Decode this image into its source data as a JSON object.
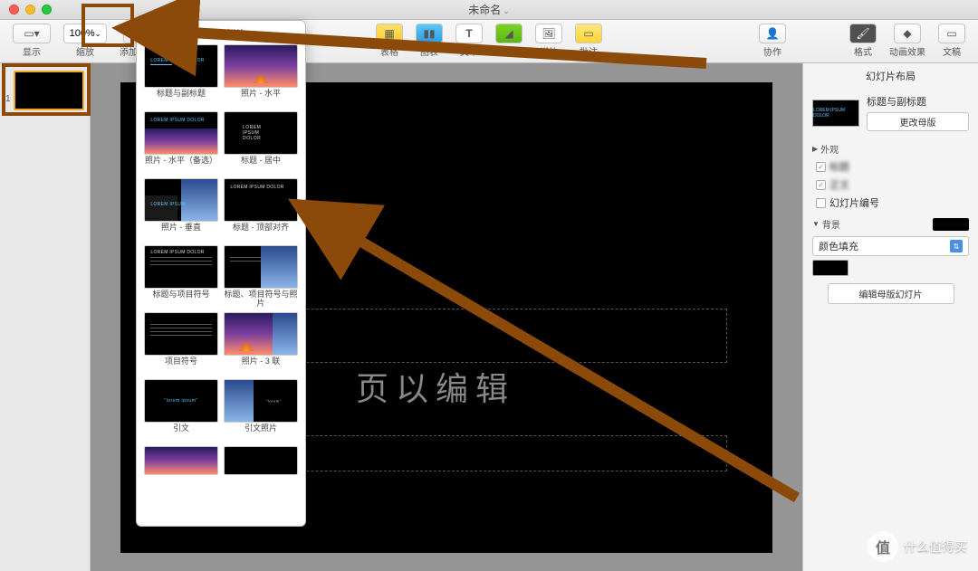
{
  "window": {
    "title": "未命名"
  },
  "toolbar": {
    "view": "显示",
    "zoom_value": "100%",
    "zoom_label": "缩放",
    "add_slide": "添加幻灯片",
    "table": "表格",
    "chart": "图表",
    "text": "文本",
    "shape": "形状",
    "media": "媒体",
    "comment": "批注",
    "collab": "协作",
    "format": "格式",
    "animate": "动画效果",
    "document": "文稿"
  },
  "slide_nav": {
    "slide1_num": "1"
  },
  "canvas": {
    "edit_hint": "页以编辑"
  },
  "popover": {
    "title": "添加幻灯片",
    "layouts": [
      {
        "label": "标题与副标题",
        "sample": "LOREM IPSUM DOLOR"
      },
      {
        "label": "照片 - 水平",
        "sample": ""
      },
      {
        "label": "照片 - 水平（备选）",
        "sample": "LOREM IPSUM DOLOR"
      },
      {
        "label": "标题 - 居中",
        "sample": "LOREM IPSUM DOLOR"
      },
      {
        "label": "照片 - 垂直",
        "sample": "LOREM IPSUM"
      },
      {
        "label": "标题 - 顶部对齐",
        "sample": "LOREM IPSUM DOLOR"
      },
      {
        "label": "标题与项目符号",
        "sample": "LOREM IPSUM DOLOR"
      },
      {
        "label": "标题、项目符号与照片",
        "sample": ""
      },
      {
        "label": "项目符号",
        "sample": ""
      },
      {
        "label": "照片 - 3 联",
        "sample": ""
      },
      {
        "label": "引文",
        "sample": ""
      },
      {
        "label": "引文照片",
        "sample": ""
      }
    ]
  },
  "inspector": {
    "title": "幻灯片布局",
    "layout_name": "标题与副标题",
    "change_master": "更改母版",
    "appearance_heading": "外观",
    "chk_title": "标题",
    "chk_body": "正文",
    "chk_slidenum": "幻灯片编号",
    "bg_heading": "背景",
    "bg_fill": "颜色填充",
    "edit_master": "编辑母版幻灯片"
  },
  "watermark": {
    "text": "什么值得买"
  }
}
